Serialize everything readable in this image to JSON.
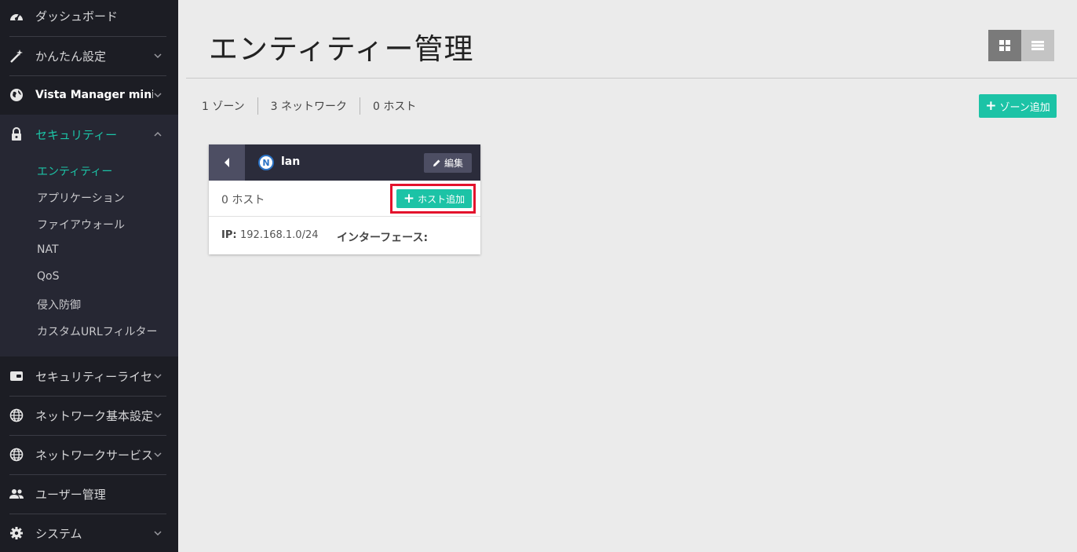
{
  "sidebar": {
    "items": [
      {
        "label": "ダッシュボード",
        "icon": "speedometer-icon"
      },
      {
        "label": "かんたん設定",
        "icon": "magic-wand-icon"
      },
      {
        "label": "Vista Manager mini",
        "icon": "globe-icon"
      },
      {
        "label": "セキュリティー",
        "icon": "lock-icon"
      },
      {
        "label": "セキュリティーライセ...",
        "icon": "license-icon"
      },
      {
        "label": "ネットワーク基本設定",
        "icon": "globe-icon"
      },
      {
        "label": "ネットワークサービス",
        "icon": "globe-icon"
      },
      {
        "label": "ユーザー管理",
        "icon": "users-icon"
      },
      {
        "label": "システム",
        "icon": "gear-icon"
      }
    ],
    "security_sub": [
      "エンティティー",
      "アプリケーション",
      "ファイアウォール",
      "NAT",
      "QoS",
      "侵入防御",
      "カスタムURLフィルター"
    ]
  },
  "main": {
    "title": "エンティティー管理",
    "stats": {
      "zones": "1 ゾーン",
      "networks": "3 ネットワーク",
      "hosts": "0 ホスト"
    },
    "add_zone_label": "ゾーン追加"
  },
  "card": {
    "badge": "N",
    "name": "lan",
    "edit_label": "編集",
    "host_count": "0 ホスト",
    "add_host_label": "ホスト追加",
    "ip_label": "IP:",
    "ip_value": "192.168.1.0/24",
    "interface_label": "インターフェース:"
  },
  "colors": {
    "accent": "#1cc3a6",
    "sidebar_bg": "#1c1d24",
    "highlight": "#e3122c"
  }
}
